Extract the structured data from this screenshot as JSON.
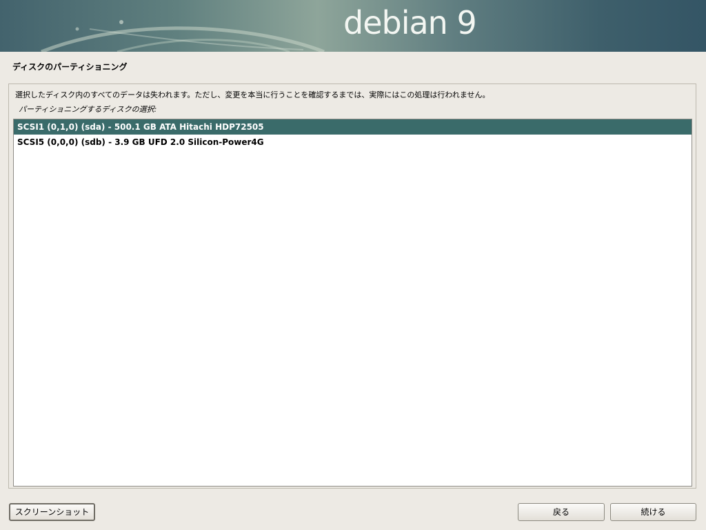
{
  "banner": {
    "brand": "debian 9"
  },
  "page": {
    "title": "ディスクのパーティショニング"
  },
  "notice": "選択したディスク内のすべてのデータは失われます。ただし、変更を本当に行うことを確認するまでは、実際にはこの処理は行われません。",
  "prompt": "パーティショニングするディスクの選択:",
  "disks": [
    {
      "label": "SCSI1 (0,1,0) (sda) - 500.1 GB ATA Hitachi HDP72505",
      "selected": true
    },
    {
      "label": "SCSI5 (0,0,0) (sdb) - 3.9 GB UFD 2.0 Silicon-Power4G",
      "selected": false
    }
  ],
  "buttons": {
    "screenshot": "スクリーンショット",
    "back": "戻る",
    "continue": "続ける"
  },
  "colors": {
    "selection": "#3a6b6a",
    "background": "#edeae4"
  }
}
